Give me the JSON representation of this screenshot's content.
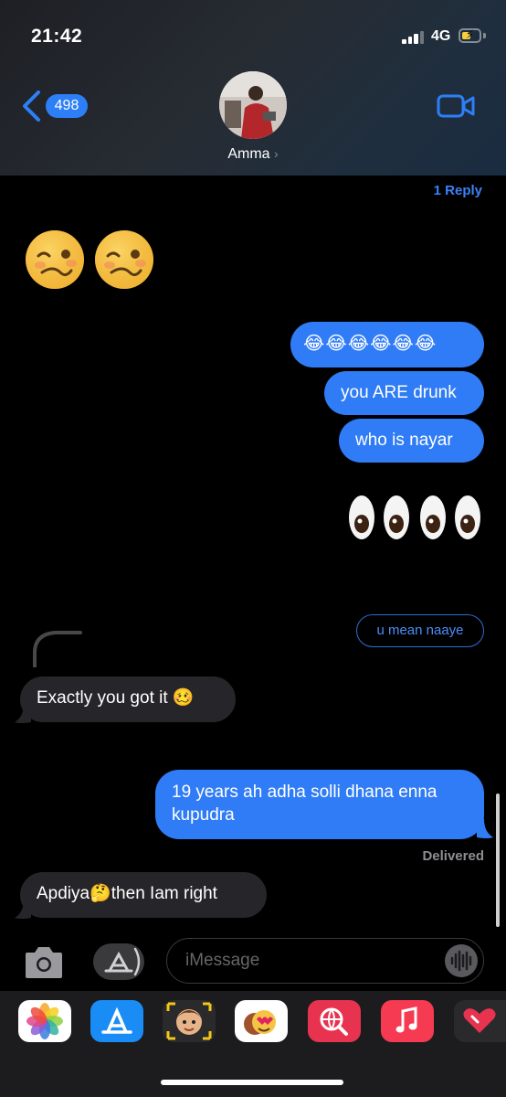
{
  "status_bar": {
    "time": "21:42",
    "network": "4G",
    "battery_level": 0.55
  },
  "nav": {
    "back_count": "498",
    "contact_name": "Amma"
  },
  "thread": {
    "reply_count": "1 Reply",
    "received_emoji_reaction": "woozy-face-emoji x2",
    "sent_laugh_bubble": "😂😂😂😂😂😂",
    "sent_messages": [
      "you ARE drunk",
      "who is nayar"
    ],
    "sent_emoji": "eyes-emoji x4",
    "reply_preview": "u mean naaye",
    "received_1": "Exactly you got it",
    "sent_long": "19 years ah adha solli dhana enna kupudra",
    "delivery_status": "Delivered",
    "received_2_part1": "Apdiya",
    "received_2_part2": "then Iam right"
  },
  "input": {
    "placeholder": "iMessage"
  },
  "app_drawer": [
    "photos-app",
    "app-store",
    "memoji-stickers",
    "animoji",
    "web-images-search",
    "music-app",
    "digital-touch"
  ],
  "colors": {
    "bubble_out": "#2f7cf6",
    "bubble_in": "#26262a",
    "accent": "#3b82f6"
  }
}
